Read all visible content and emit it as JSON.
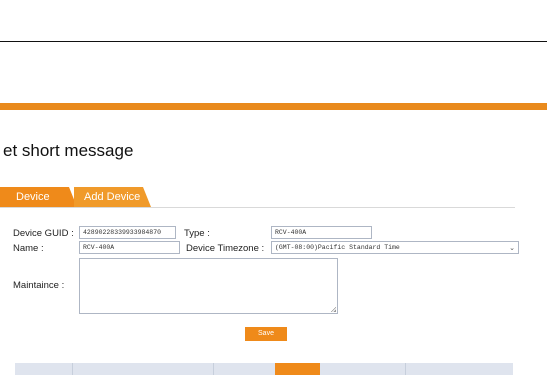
{
  "page": {
    "message": "et short message"
  },
  "tabs": [
    {
      "label": "Device"
    },
    {
      "label": "Add Device"
    }
  ],
  "form": {
    "guid_label": "Device GUID :",
    "guid_value": "42890228339933984870",
    "type_label": "Type :",
    "type_value": "RCV-400A",
    "name_label": "Name :",
    "name_value": "RCV-400A",
    "timezone_label": "Device Timezone :",
    "timezone_value": "(GMT-08:00)Pacific Standard Time",
    "maintaince_label": "Maintaince :",
    "maintaince_value": "",
    "save_label": "Save"
  },
  "colors": {
    "accent": "#ef8a1a",
    "band": "#e98a1d"
  }
}
